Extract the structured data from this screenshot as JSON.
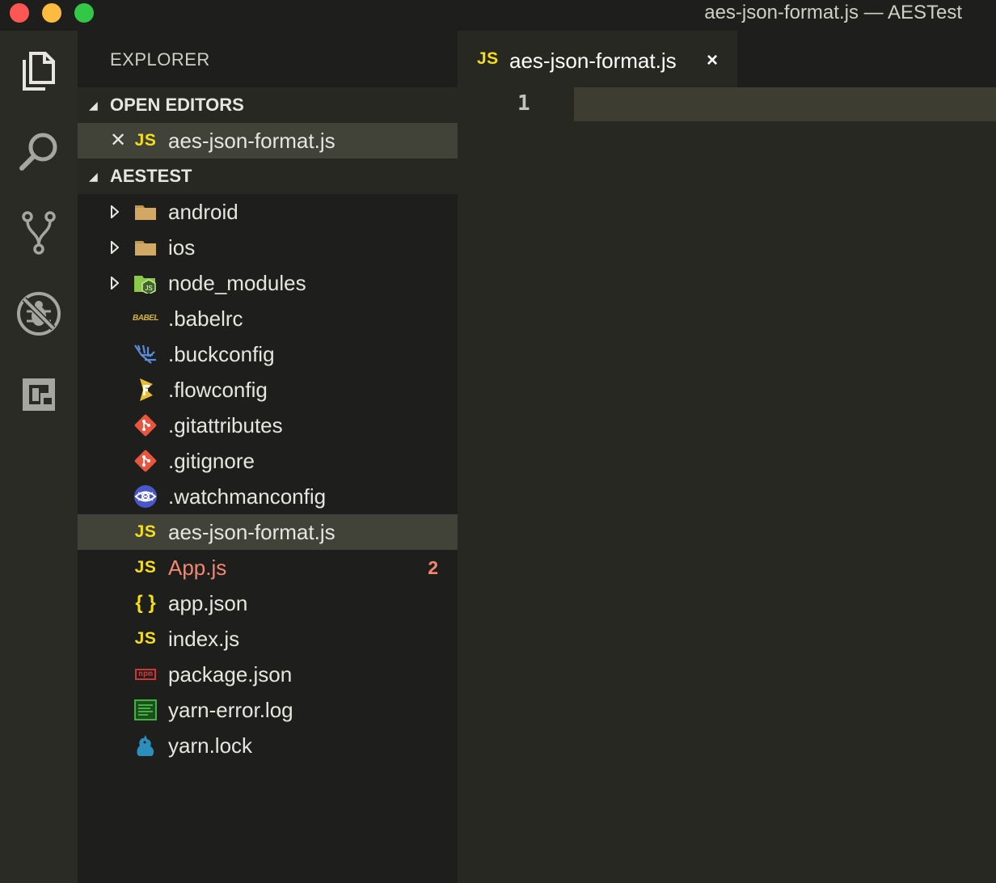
{
  "window": {
    "title": "aes-json-format.js — AESTest"
  },
  "activity_bar": {
    "items": [
      {
        "name": "explorer",
        "icon": "files-icon"
      },
      {
        "name": "search",
        "icon": "search-icon"
      },
      {
        "name": "source-control",
        "icon": "git-branch-icon"
      },
      {
        "name": "debug",
        "icon": "no-bug-icon"
      },
      {
        "name": "extensions",
        "icon": "extensions-icon"
      }
    ]
  },
  "sidebar": {
    "title": "EXPLORER",
    "open_editors": {
      "label": "OPEN EDITORS",
      "items": [
        {
          "icon_text": "JS",
          "label": "aes-json-format.js"
        }
      ]
    },
    "workspace": {
      "label": "AESTEST",
      "items": [
        {
          "label": "android",
          "kind": "folder",
          "icon": "folder-icon"
        },
        {
          "label": "ios",
          "kind": "folder",
          "icon": "folder-icon"
        },
        {
          "label": "node_modules",
          "kind": "folder",
          "icon": "node-folder-icon"
        },
        {
          "label": ".babelrc",
          "kind": "file",
          "icon": "babel-icon",
          "icon_text": "BABEL"
        },
        {
          "label": ".buckconfig",
          "kind": "file",
          "icon": "buck-icon"
        },
        {
          "label": ".flowconfig",
          "kind": "file",
          "icon": "flow-icon"
        },
        {
          "label": ".gitattributes",
          "kind": "file",
          "icon": "git-icon"
        },
        {
          "label": ".gitignore",
          "kind": "file",
          "icon": "git-icon"
        },
        {
          "label": ".watchmanconfig",
          "kind": "file",
          "icon": "watchman-icon"
        },
        {
          "label": "aes-json-format.js",
          "kind": "file",
          "icon": "js-icon",
          "icon_text": "JS",
          "selected": true
        },
        {
          "label": "App.js",
          "kind": "file",
          "icon": "js-icon",
          "icon_text": "JS",
          "modified": true,
          "badge": "2"
        },
        {
          "label": "app.json",
          "kind": "file",
          "icon": "json-icon",
          "icon_text": "{ }"
        },
        {
          "label": "index.js",
          "kind": "file",
          "icon": "js-icon",
          "icon_text": "JS"
        },
        {
          "label": "package.json",
          "kind": "file",
          "icon": "npm-icon",
          "icon_text": "npm"
        },
        {
          "label": "yarn-error.log",
          "kind": "file",
          "icon": "log-icon"
        },
        {
          "label": "yarn.lock",
          "kind": "file",
          "icon": "yarn-icon"
        }
      ]
    }
  },
  "editor": {
    "tab": {
      "icon_text": "JS",
      "label": "aes-json-format.js",
      "close": "×"
    },
    "line_numbers": [
      "1"
    ]
  },
  "colors": {
    "background": "#272822",
    "sidebar": "#1e1f1c",
    "js_yellow": "#f5de19",
    "modified": "#f48771",
    "folder": "#c09553"
  }
}
